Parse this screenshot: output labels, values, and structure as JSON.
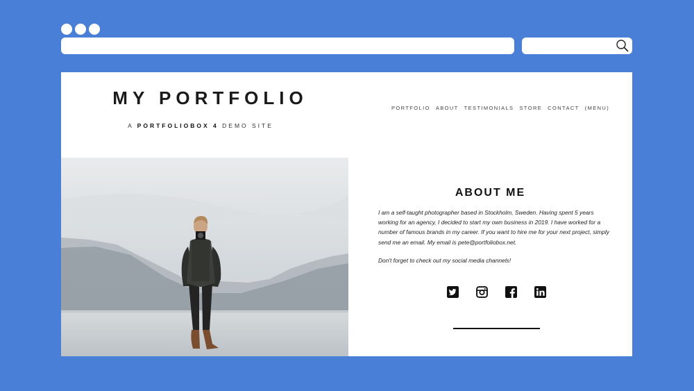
{
  "site": {
    "logo": "MY PORTFOLIO",
    "tagline_prefix": "A",
    "tagline_brand": "PORTFOLIOBOX 4",
    "tagline_suffix": "DEMO SITE"
  },
  "nav": {
    "items": [
      "PORTFOLIO",
      "ABOUT",
      "TESTIMONIALS",
      "STORE",
      "CONTACT",
      "(MENU)"
    ]
  },
  "about": {
    "title": "ABOUT ME",
    "paragraph1": "I am a self-taught photographer based in Stockholm, Sweden. Having spent 5 years working for an agency, I decided to start my own business in 2019. I have worked for a number of famous brands in my career. If you want to hire me for your next project, simply send me an email. My email is pete@portfoliobox.net.",
    "paragraph2": "Don't forget to check out my social media channels!"
  },
  "socials": [
    "twitter-icon",
    "instagram-icon",
    "facebook-icon",
    "linkedin-icon"
  ],
  "colors": {
    "background": "#4a7fd8",
    "text": "#111111",
    "page": "#ffffff"
  }
}
